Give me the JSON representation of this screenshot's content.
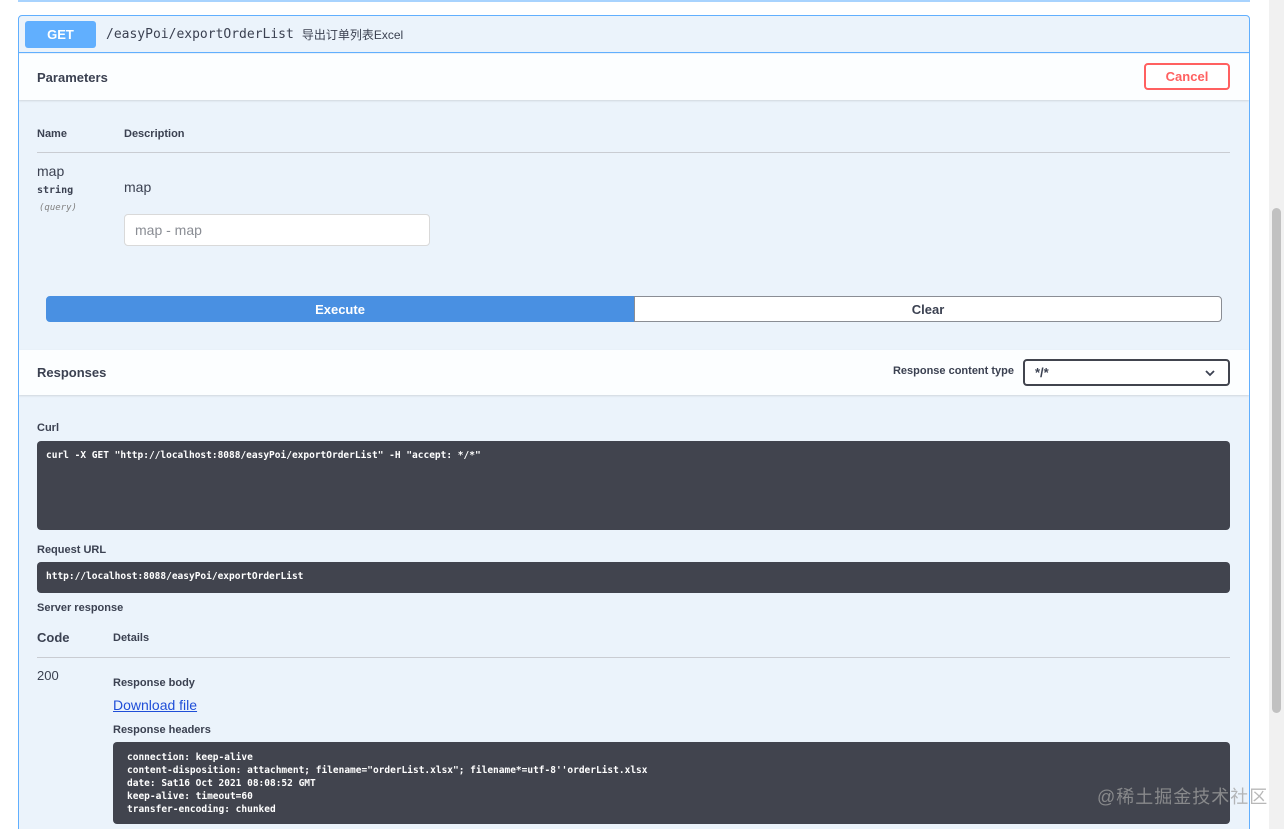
{
  "operation": {
    "method": "GET",
    "path": "/easyPoi/exportOrderList",
    "summary": "导出订单列表Excel"
  },
  "parameters": {
    "title": "Parameters",
    "cancel_label": "Cancel",
    "col_name": "Name",
    "col_description": "Description",
    "items": [
      {
        "name": "map",
        "type": "string",
        "in": "(query)",
        "description": "map",
        "placeholder": "map - map",
        "value": ""
      }
    ]
  },
  "actions": {
    "execute_label": "Execute",
    "clear_label": "Clear"
  },
  "responses": {
    "title": "Responses",
    "content_type_label": "Response content type",
    "content_type_value": "*/*",
    "curl_label": "Curl",
    "curl_command": "curl -X GET \"http://localhost:8088/easyPoi/exportOrderList\" -H \"accept: */*\"",
    "request_url_label": "Request URL",
    "request_url": "http://localhost:8088/easyPoi/exportOrderList",
    "server_response_label": "Server response",
    "col_code": "Code",
    "col_details": "Details",
    "status_code": "200",
    "response_body_label": "Response body",
    "download_label": "Download file",
    "response_headers_label": "Response headers",
    "headers": [
      "connection: keep-alive",
      "content-disposition: attachment; filename=\"orderList.xlsx\"; filename*=utf-8''orderList.xlsx",
      "date: Sat16 Oct 2021 08:08:52 GMT",
      "keep-alive: timeout=60",
      "transfer-encoding: chunked"
    ]
  },
  "watermark": "@稀土掘金技术社区",
  "colors": {
    "get": "#61affe",
    "execute": "#4990e2",
    "cancel": "#ff6060",
    "code_bg": "#41444e"
  }
}
